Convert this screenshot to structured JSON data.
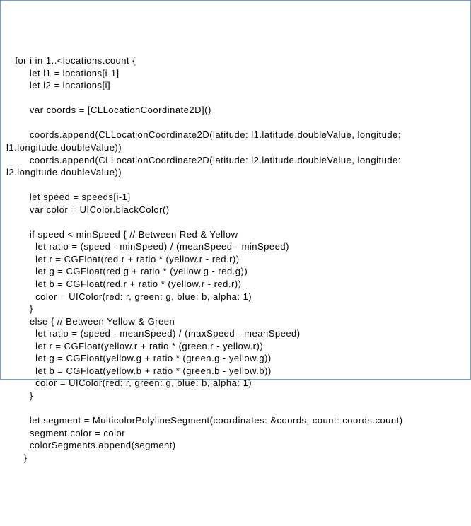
{
  "code": {
    "line1": "   for i in 1..<locations.count {",
    "line2": "        let l1 = locations[i-1]",
    "line3": "        let l2 = locations[i]",
    "line4": "",
    "line5": "        var coords = [CLLocationCoordinate2D]()",
    "line6": "",
    "line7": "        coords.append(CLLocationCoordinate2D(latitude: l1.latitude.doubleValue, longitude: l1.longitude.doubleValue))",
    "line8": "        coords.append(CLLocationCoordinate2D(latitude: l2.latitude.doubleValue, longitude: l2.longitude.doubleValue))",
    "line9": "",
    "line10": "        let speed = speeds[i-1]",
    "line11": "        var color = UIColor.blackColor()",
    "line12": "",
    "line13": "        if speed < minSpeed { // Between Red & Yellow",
    "line14": "          let ratio = (speed - minSpeed) / (meanSpeed - minSpeed)",
    "line15": "          let r = CGFloat(red.r + ratio * (yellow.r - red.r))",
    "line16": "          let g = CGFloat(red.g + ratio * (yellow.g - red.g))",
    "line17": "          let b = CGFloat(red.r + ratio * (yellow.r - red.r))",
    "line18": "          color = UIColor(red: r, green: g, blue: b, alpha: 1)",
    "line19": "        }",
    "line20": "        else { // Between Yellow & Green",
    "line21": "          let ratio = (speed - meanSpeed) / (maxSpeed - meanSpeed)",
    "line22": "          let r = CGFloat(yellow.r + ratio * (green.r - yellow.r))",
    "line23": "          let g = CGFloat(yellow.g + ratio * (green.g - yellow.g))",
    "line24": "          let b = CGFloat(yellow.b + ratio * (green.b - yellow.b))",
    "line25": "          color = UIColor(red: r, green: g, blue: b, alpha: 1)",
    "line26": "        }",
    "line27": "",
    "line28": "        let segment = MulticolorPolylineSegment(coordinates: &coords, count: coords.count)",
    "line29": "        segment.color = color",
    "line30": "        colorSegments.append(segment)",
    "line31": "      }"
  }
}
